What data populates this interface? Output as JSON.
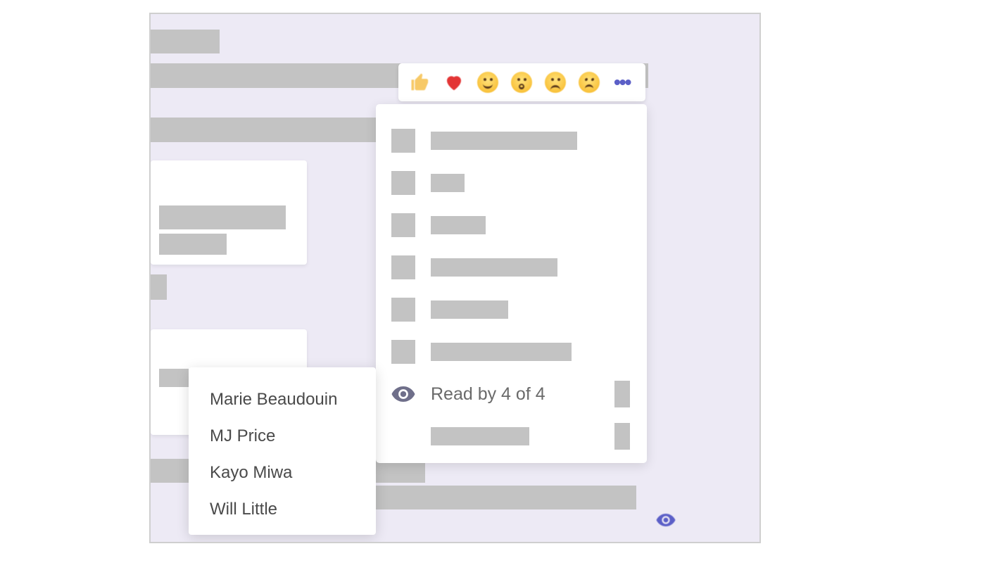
{
  "reactions": {
    "like": "like-icon",
    "heart": "heart-icon",
    "laugh": "laugh-icon",
    "surprised": "surprised-icon",
    "sad": "sad-icon",
    "angry": "angry-icon",
    "more": "•••"
  },
  "context_menu": {
    "read_by_label": "Read by 4 of 4"
  },
  "readers": {
    "r0": "Marie Beaudouin",
    "r1": "MJ Price",
    "r2": "Kayo Miwa",
    "r3": "Will Little"
  }
}
